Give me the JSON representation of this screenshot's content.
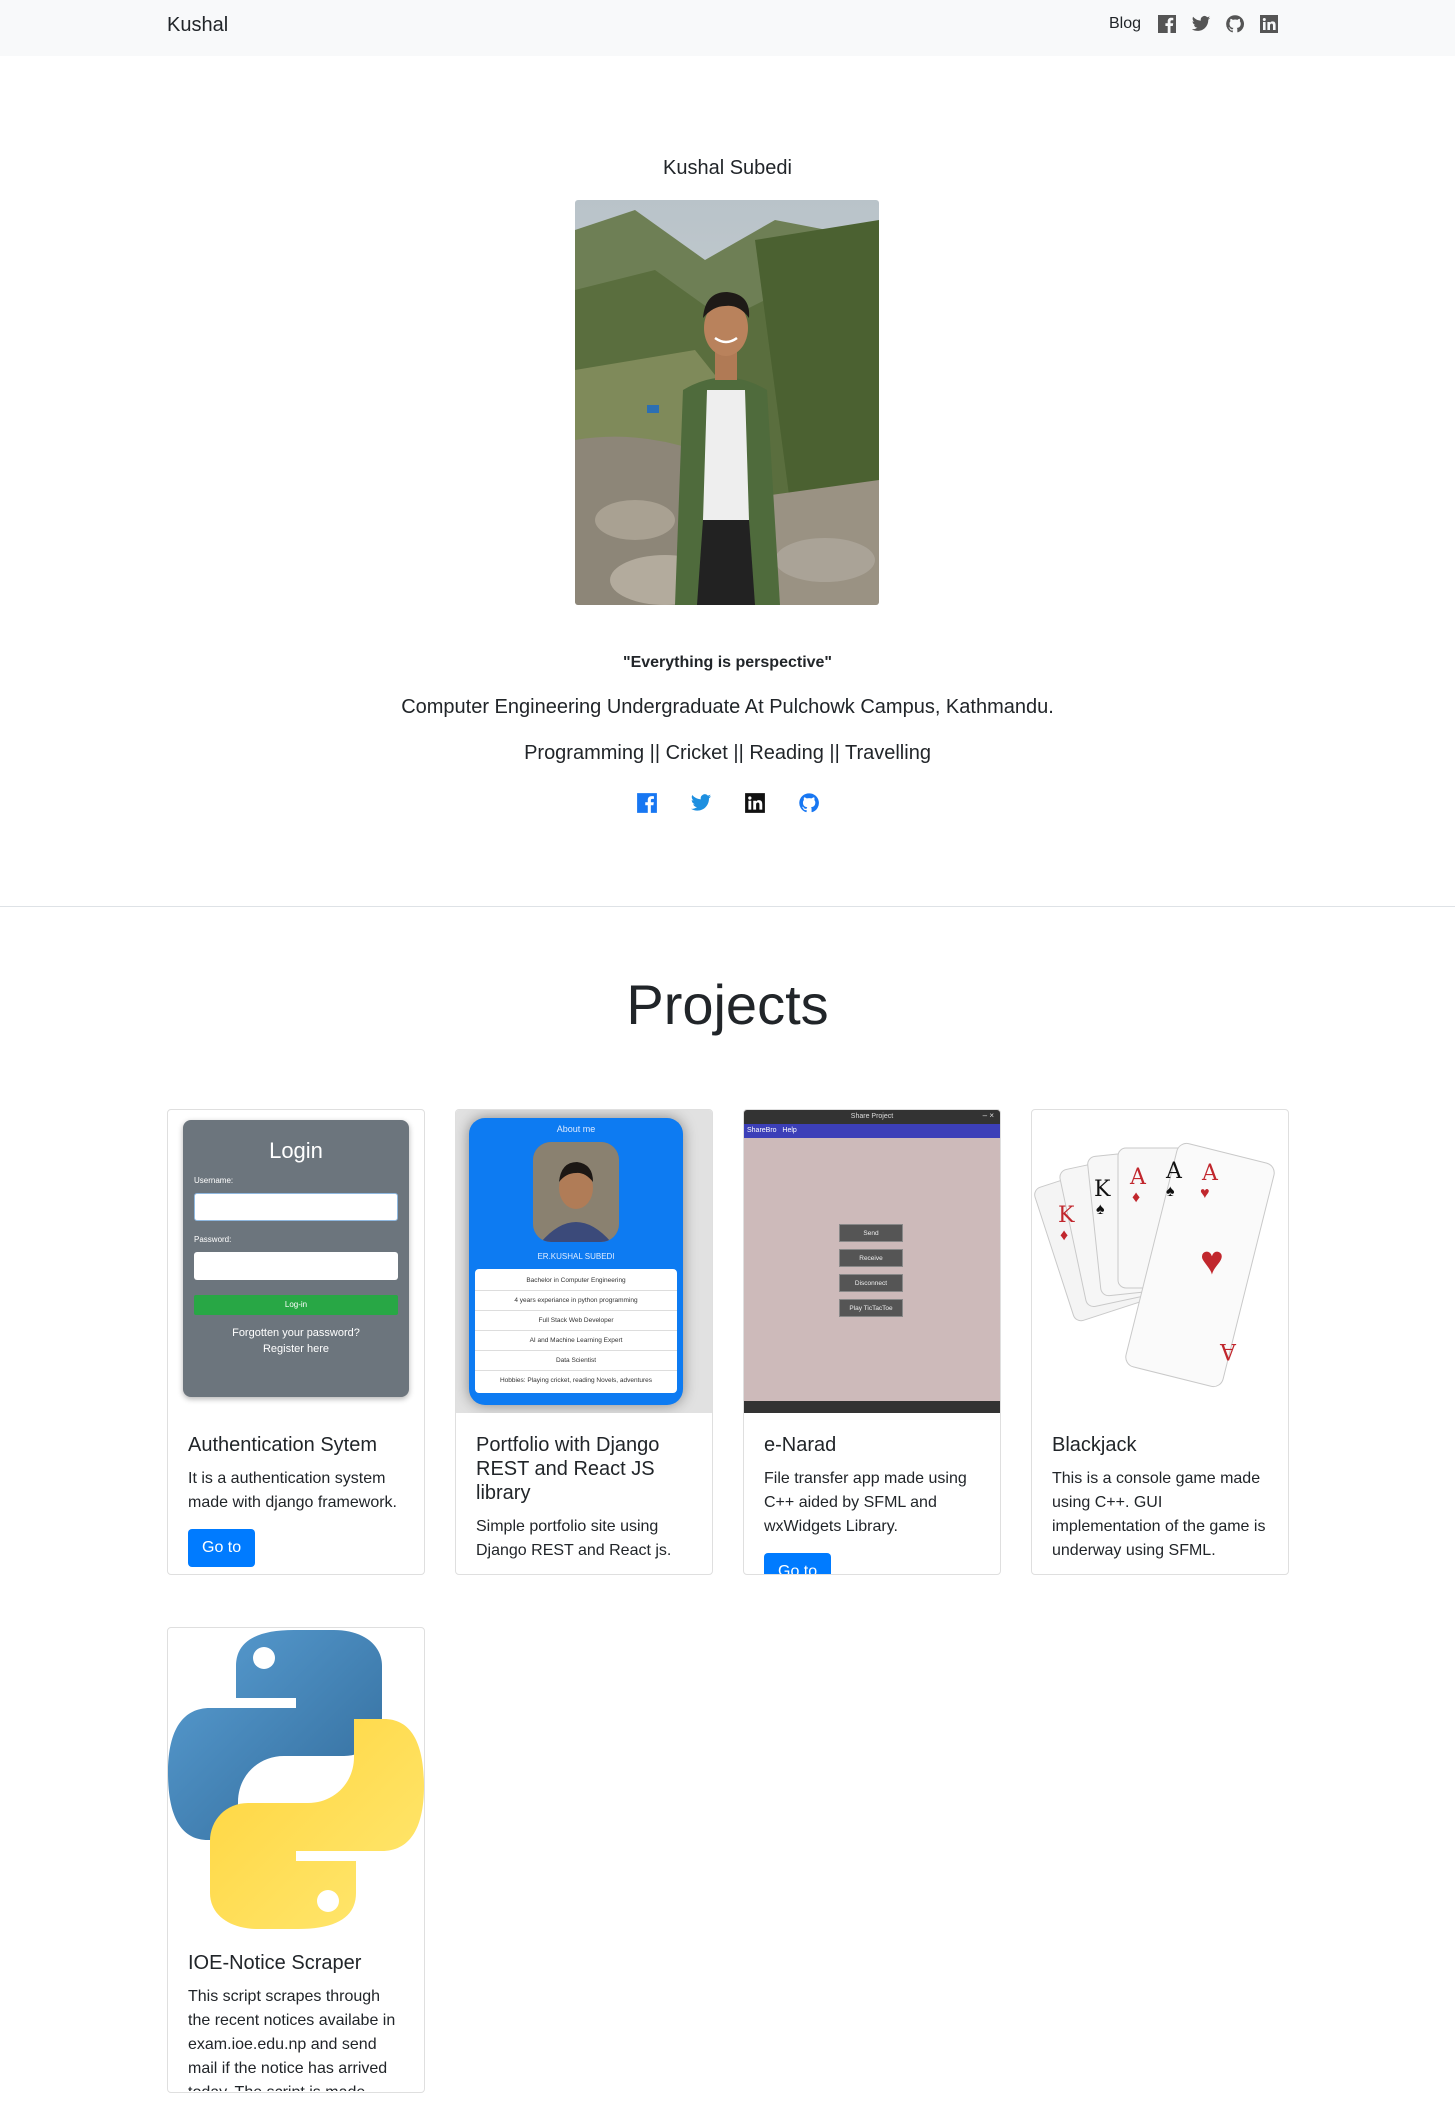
{
  "navbar": {
    "brand": "Kushal",
    "blog_label": "Blog",
    "icons": [
      "facebook-icon",
      "twitter-icon",
      "github-icon",
      "linkedin-icon"
    ]
  },
  "hero": {
    "name": "Kushal Subedi",
    "quote": "\"Everything is perspective\"",
    "subtitle": "Computer Engineering Undergraduate At Pulchowk Campus, Kathmandu.",
    "hobbies": "Programming || Cricket || Reading || Travelling",
    "social_icons": [
      "facebook-icon",
      "twitter-icon",
      "linkedin-icon",
      "github-icon"
    ]
  },
  "projects": {
    "title": "Projects",
    "items": [
      {
        "title": "Authentication Sytem",
        "description": "It is a authentication system made with django framework.",
        "button": "Go to",
        "preview": {
          "heading": "Login",
          "username_label": "Username:",
          "password_label": "Password:",
          "login_button": "Log-in",
          "forgot_link": "Forgotten your password?",
          "register_link": "Register here"
        }
      },
      {
        "title": "Portfolio with Django REST and React JS library",
        "description": "Simple portfolio site using Django REST and React js.",
        "preview": {
          "heading": "About me",
          "name": "ER.KUSHAL SUBEDI",
          "list": [
            "Bachelor in Computer Engineering",
            "4 years experiance in python programming",
            "Full Stack Web Developer",
            "AI and Machine Learning Expert",
            "Data Scientist",
            "Hobbies: Playing cricket, reading Novels, adventures"
          ]
        }
      },
      {
        "title": "e-Narad",
        "description": "File transfer app made using C++ aided by SFML and wxWidgets Library.",
        "button": "Go to",
        "preview": {
          "window_title": "Share Project",
          "menu": "ShareBro   Help",
          "buttons": [
            "Send",
            "Receive",
            "Disconnect",
            "Play TicTacToe"
          ]
        }
      },
      {
        "title": "Blackjack",
        "description": "This is a console game made using C++. GUI implementation of the game is underway using SFML."
      },
      {
        "title": "IOE-Notice Scraper",
        "description": "This script scrapes through the recent notices availabe in exam.ioe.edu.np and send mail if the notice has arrived today. The script is made"
      }
    ]
  },
  "colors": {
    "primary": "#007bff",
    "navbar_bg": "#f8f9fa",
    "text": "#212529"
  }
}
